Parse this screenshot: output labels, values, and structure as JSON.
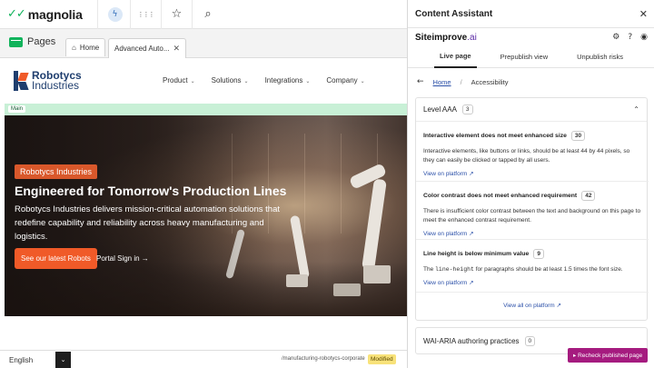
{
  "app": {
    "logo_mark": "✓✓",
    "logo_text": "magnolia"
  },
  "toolbar": {
    "app_icon": "app-launcher-icon",
    "grid_icon": "⋮⋮⋮",
    "star_icon": "☆",
    "search_icon": "⌕"
  },
  "pages": {
    "title": "Pages",
    "tabs": [
      {
        "label": "Home",
        "icon": "⌂"
      },
      {
        "label": "Advanced Auto...",
        "close": "✕"
      }
    ]
  },
  "site": {
    "brand_line1": "Robotycs",
    "brand_line2": "Industries",
    "menu": [
      {
        "label": "Product"
      },
      {
        "label": "Solutions"
      },
      {
        "label": "Integrations"
      },
      {
        "label": "Company"
      }
    ],
    "menu_caret": "⌄",
    "main_label": "Main",
    "hero": {
      "tag": "Robotycs Industries",
      "title": "Engineered for Tomorrow's Production Lines",
      "desc": "Robotycs Industries delivers mission-critical automation solutions that redefine capability and reliability across heavy manufacturing and logistics.",
      "cta": "See our latest Robots",
      "portal": "Portal Sign in →"
    }
  },
  "bottom": {
    "language": "English",
    "lang_caret": "⌄",
    "path": "/manufacturing-robotycs-corporate",
    "status": "Modified"
  },
  "panel": {
    "title": "Content Assistant",
    "close": "✕",
    "si_logo": "Siteimprove",
    "si_logo_ai": ".ai",
    "icons": {
      "settings": "⚙",
      "help": "?",
      "user": "◉"
    },
    "tabs": [
      "Live page",
      "Prepublish view",
      "Unpublish risks"
    ],
    "crumb_back": "←",
    "crumb_home": "Home",
    "crumb_sep": "/",
    "crumb_current": "Accessibility",
    "level": {
      "label": "Level AAA",
      "count": "3",
      "chevron": "⌃"
    },
    "issues": [
      {
        "title": "Interactive element does not meet enhanced size",
        "count": "30",
        "desc": "Interactive elements, like buttons or links, should be at least 44 by 44 pixels, so they can easily be clicked or tapped by all users.",
        "link": "View on platform ↗"
      },
      {
        "title": "Color contrast does not meet enhanced requirement",
        "count": "42",
        "desc": "There is insufficient color contrast between the text and background on this page to meet the enhanced contrast requirement.",
        "link": "View on platform ↗"
      },
      {
        "title": "Line height is below minimum value",
        "count": "9",
        "desc_pre": "The ",
        "desc_code": "line-height",
        "desc_post": " for paragraphs should be at least 1.5 times the font size.",
        "link": "View on platform ↗"
      }
    ],
    "view_all": "View all on platform ↗",
    "aria": {
      "label": "WAI-ARIA authoring practices",
      "count": "0"
    },
    "recheck": "▸ Recheck published page"
  },
  "colors": {
    "brand_green": "#11b35b",
    "accent_orange": "#f05a28",
    "link_blue": "#2a4fa8",
    "recheck_magenta": "#a51b7f"
  }
}
